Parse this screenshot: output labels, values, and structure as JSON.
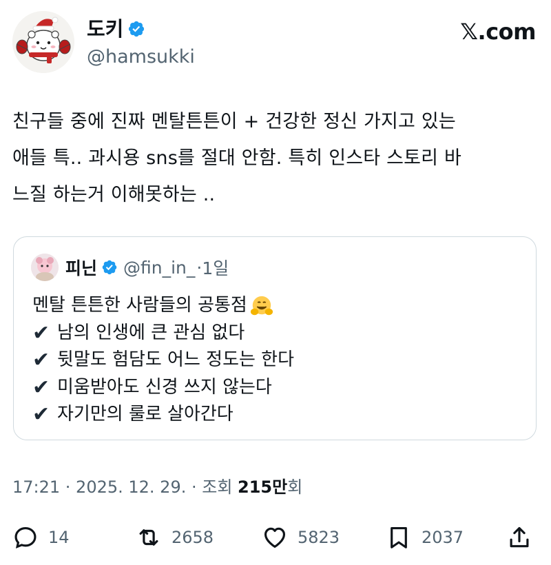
{
  "author": {
    "display_name": "도키",
    "handle": "@hamsukki"
  },
  "brand": "𝕏.com",
  "tweet": {
    "text": "친구들 중에 진짜 멘탈튼튼이 + 건강한 정신 가지고 있는\n애들 특.. 과시용 sns를 절대 안함. 특히 인스타 스토리 바\n느질 하는거 이해못하는 .."
  },
  "quote": {
    "display_name": "피닌",
    "handle": "@fin_in_",
    "separator": "·",
    "time": "1일",
    "title": "멘탈 튼튼한 사람들의 공통점",
    "check_glyph": "✔",
    "items": [
      "남의 인생에 큰 관심 없다",
      "뒷말도 험담도 어느 정도는 한다",
      "미움받아도 신경 쓰지 않는다",
      "자기만의 룰로 살아간다"
    ]
  },
  "meta": {
    "time_date": "17:21 · 2025. 12. 29. · 조회 ",
    "views": "215만",
    "views_suffix": "회"
  },
  "actions": {
    "replies": "14",
    "reposts": "2658",
    "likes": "5823",
    "bookmarks": "2037"
  },
  "icons": [
    "verified-badge-icon",
    "comment-icon",
    "repost-icon",
    "heart-icon",
    "bookmark-icon",
    "share-icon",
    "hugging-face-emoji"
  ],
  "colors": {
    "verified": "#1d9bf0",
    "secondary_text": "#536471",
    "border": "#cfd9de"
  }
}
